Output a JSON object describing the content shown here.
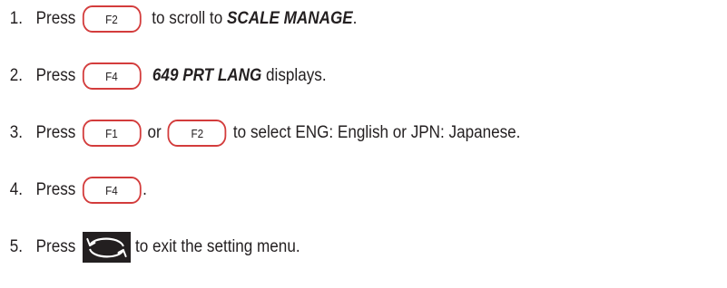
{
  "steps": [
    {
      "number": "1.",
      "press": "Press",
      "key": "F2",
      "text_a": " to scroll to ",
      "emphasis": "SCALE MANAGE",
      "text_b": "."
    },
    {
      "number": "2.",
      "press": "Press",
      "key": "F4",
      "emphasis": "649 PRT LANG",
      "text_a": " displays."
    },
    {
      "number": "3.",
      "press": "Press",
      "key": "F1",
      "connector": "or",
      "key2": "F2",
      "text_a": "to select ENG: English or JPN: Japanese."
    },
    {
      "number": "4.",
      "press": "Press",
      "key": "F4",
      "text_a": "."
    },
    {
      "number": "5.",
      "press": "Press",
      "icon": "exit-cycle-icon",
      "text_a": "to exit the setting menu."
    }
  ],
  "colors": {
    "key_border": "#d33c3c",
    "icon_background": "#231f20",
    "text": "#231f20"
  }
}
